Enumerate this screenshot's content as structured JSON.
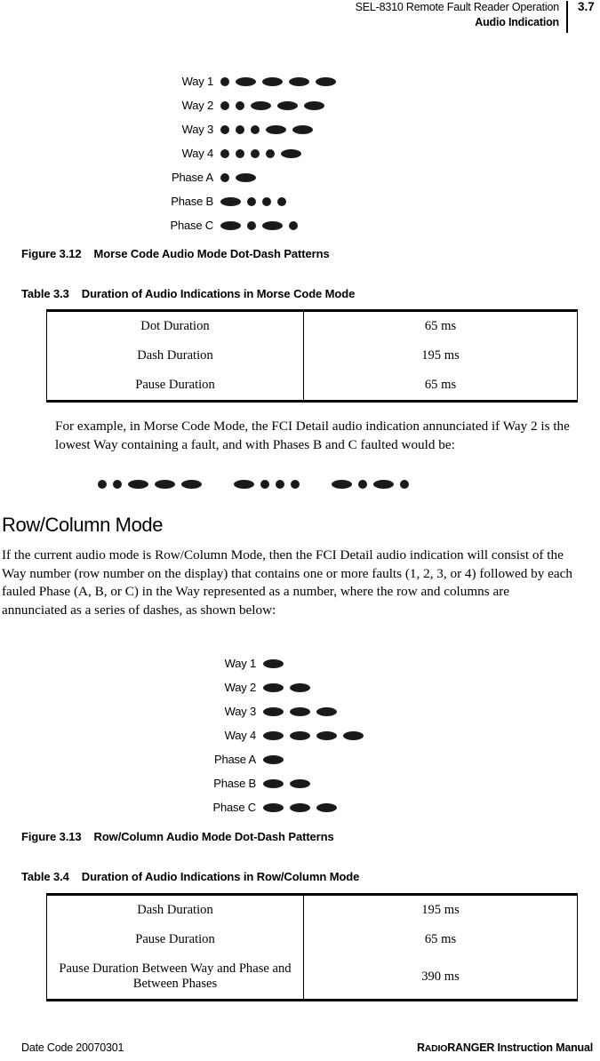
{
  "header": {
    "line1": "SEL-8310 Remote Fault Reader Operation",
    "line2": "Audio Indication",
    "page_number": "3.7"
  },
  "figure_morse": {
    "caption_number": "Figure 3.12",
    "caption_title": "Morse Code Audio Mode Dot-Dash Patterns",
    "rows": [
      {
        "label": "Way 1",
        "pattern": "dot dash dash dash dash"
      },
      {
        "label": "Way 2",
        "pattern": "dot dot dash dash dash"
      },
      {
        "label": "Way 3",
        "pattern": "dot dot dot dash dash"
      },
      {
        "label": "Way 4",
        "pattern": "dot dot dot dot dash"
      },
      {
        "label": "Phase A",
        "pattern": "dot dash"
      },
      {
        "label": "Phase B",
        "pattern": "dash dot dot dot"
      },
      {
        "label": "Phase C",
        "pattern": "dash dot dash dot"
      }
    ]
  },
  "table_3_3": {
    "caption_number": "Table 3.3",
    "caption_title": "Duration of Audio Indications in Morse Code Mode",
    "rows": [
      {
        "label": "Dot Duration",
        "value": "65 ms"
      },
      {
        "label": "Dash Duration",
        "value": "195 ms"
      },
      {
        "label": "Pause Duration",
        "value": "65 ms"
      }
    ]
  },
  "example": {
    "paragraph": "For example, in Morse Code Mode, the FCI Detail audio indication annunciated if Way 2 is the lowest Way containing a fault, and with Phases B and C faulted would be:",
    "sequence": "dot dot dash dash dash gap dash dot dot dot gap dash dot dash dot"
  },
  "row_column_section": {
    "heading": "Row/Column Mode",
    "paragraph": "If the current audio mode is Row/Column Mode, then the FCI Detail audio indication will consist of the Way number (row number on the display) that contains one or more faults (1, 2, 3, or 4) followed by each fauled Phase (A, B, or C) in the Way represented as a number, where the row and columns are annunciated as a series of dashes, as shown below:"
  },
  "figure_rowcolumn": {
    "caption_number": "Figure 3.13",
    "caption_title": "Row/Column Audio Mode Dot-Dash Patterns",
    "rows": [
      {
        "label": "Way 1",
        "pattern": "dash"
      },
      {
        "label": "Way 2",
        "pattern": "dash dash"
      },
      {
        "label": "Way 3",
        "pattern": "dash dash dash"
      },
      {
        "label": "Way 4",
        "pattern": "dash dash dash dash"
      },
      {
        "label": "Phase A",
        "pattern": "dash"
      },
      {
        "label": "Phase B",
        "pattern": "dash dash"
      },
      {
        "label": "Phase C",
        "pattern": "dash dash dash"
      }
    ]
  },
  "table_3_4": {
    "caption_number": "Table 3.4",
    "caption_title": "Duration of Audio Indications in Row/Column Mode",
    "rows": [
      {
        "label": "Dash Duration",
        "value": "195 ms"
      },
      {
        "label": "Pause Duration",
        "value": "65 ms"
      },
      {
        "label": "Pause Duration Between Way and Phase and Between Phases",
        "value": "390 ms"
      }
    ]
  },
  "footer": {
    "left": "Date Code 20070301",
    "right_prefix": "R",
    "right_smallcaps": "ADIO",
    "right_suffix": "RANGER Instruction Manual"
  }
}
